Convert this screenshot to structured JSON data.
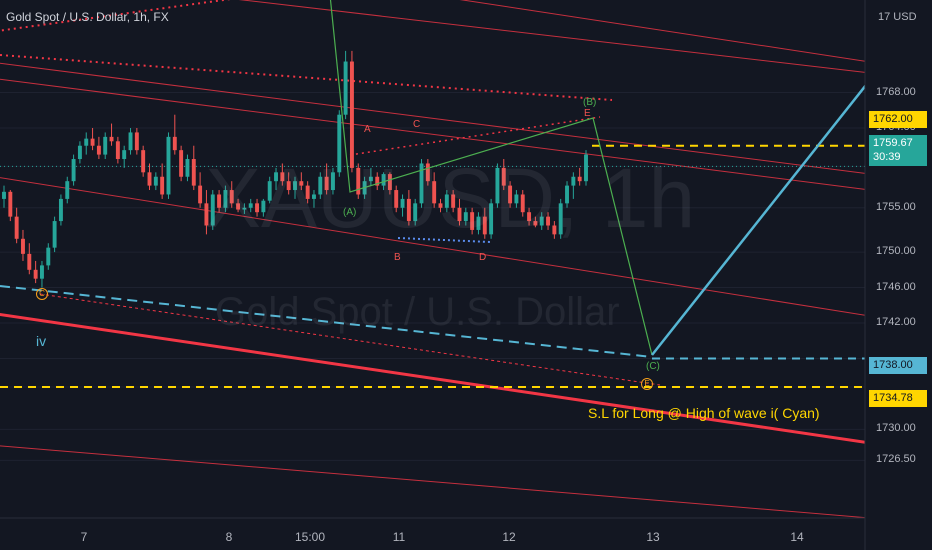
{
  "header": {
    "symbol_title": "Gold Spot / U.S. Dollar, 1h, FX"
  },
  "watermark": {
    "ticker": "XAUUSD, 1h",
    "name": "Gold Spot / U.S. Dollar"
  },
  "currency_label": "17 USD",
  "last_price": {
    "price": "1759.67",
    "countdown": "30:39"
  },
  "labels": {
    "sl_note": "S.L for Long @ High of wave i( Cyan)",
    "iv": "iv",
    "A": "A",
    "B": "B",
    "C": "C",
    "D": "D",
    "E": "E",
    "wA": "(A)",
    "wB": "(B)",
    "wC": "(C)",
    "cC": "C",
    "cE": "E"
  },
  "colors": {
    "background": "#131722",
    "up": "#26a69a",
    "down": "#ef5350",
    "channel_red": "#f23645",
    "yellow_level": "#ffd600",
    "cyan": "#56b6d4",
    "wave_green": "#4caf50",
    "orange": "#f7a21b"
  },
  "chart_data": {
    "type": "candlestick",
    "symbol": "XAUUSD",
    "timeframe": "1h",
    "y_axis_ticks": [
      1768.0,
      1764.0,
      1759.67,
      1755.0,
      1750.0,
      1746.0,
      1742.0,
      1738.0,
      1734.78,
      1730.0,
      1726.5
    ],
    "ylim": [
      1723.5,
      1772.7
    ],
    "x_axis_ticks": [
      "7",
      "8",
      "15:00",
      "11",
      "12",
      "13",
      "14"
    ],
    "horizontal_levels": [
      {
        "price": 1762.0,
        "label": "1762.00",
        "style": "dashed",
        "color": "yellow"
      },
      {
        "price": 1738.0,
        "label": "1738.00",
        "style": "dashed",
        "color": "cyan"
      },
      {
        "price": 1734.78,
        "label": "1734.78",
        "style": "dashed",
        "color": "yellow"
      }
    ],
    "last_price": 1759.67,
    "candles_ohlc": [
      [
        1756,
        1757.5,
        1755,
        1756.8
      ],
      [
        1756.8,
        1757,
        1753.5,
        1754
      ],
      [
        1754,
        1755,
        1751,
        1751.5
      ],
      [
        1751.5,
        1752.5,
        1749,
        1749.8
      ],
      [
        1749.8,
        1751,
        1747.5,
        1748
      ],
      [
        1748,
        1749,
        1746.5,
        1747
      ],
      [
        1747,
        1749,
        1746,
        1748.5
      ],
      [
        1748.5,
        1751,
        1748,
        1750.5
      ],
      [
        1750.5,
        1754,
        1750,
        1753.5
      ],
      [
        1753.5,
        1756.5,
        1753,
        1756
      ],
      [
        1756,
        1758.5,
        1755.5,
        1758
      ],
      [
        1758,
        1761,
        1757.5,
        1760.5
      ],
      [
        1760.5,
        1762.5,
        1760,
        1762
      ],
      [
        1762,
        1763.5,
        1761,
        1762.8
      ],
      [
        1762.8,
        1764,
        1761.5,
        1762
      ],
      [
        1762,
        1763,
        1760.5,
        1761
      ],
      [
        1761,
        1763.5,
        1760.5,
        1763
      ],
      [
        1763,
        1764.5,
        1762,
        1762.5
      ],
      [
        1762.5,
        1763,
        1760,
        1760.5
      ],
      [
        1760.5,
        1762,
        1759.5,
        1761.5
      ],
      [
        1761.5,
        1764,
        1761,
        1763.5
      ],
      [
        1763.5,
        1764,
        1761,
        1761.5
      ],
      [
        1761.5,
        1762,
        1758.5,
        1759
      ],
      [
        1759,
        1760,
        1757,
        1757.5
      ],
      [
        1757.5,
        1759,
        1757,
        1758.5
      ],
      [
        1758.5,
        1760,
        1756,
        1756.5
      ],
      [
        1756.5,
        1763.5,
        1756,
        1763
      ],
      [
        1763,
        1765.5,
        1761,
        1761.5
      ],
      [
        1761.5,
        1762,
        1758,
        1758.5
      ],
      [
        1758.5,
        1761,
        1758,
        1760.5
      ],
      [
        1760.5,
        1762,
        1757,
        1757.5
      ],
      [
        1757.5,
        1759,
        1755,
        1755.5
      ],
      [
        1755.5,
        1757,
        1752,
        1753
      ],
      [
        1753,
        1757,
        1752.5,
        1756.5
      ],
      [
        1756.5,
        1757,
        1754.5,
        1755
      ],
      [
        1755,
        1757.5,
        1754.5,
        1757
      ],
      [
        1757,
        1758,
        1755,
        1755.5
      ],
      [
        1755.5,
        1756,
        1754.5,
        1754.8
      ],
      [
        1754.8,
        1755.5,
        1754.3,
        1755
      ],
      [
        1755,
        1756,
        1754.5,
        1755.5
      ],
      [
        1755.5,
        1756,
        1754,
        1754.5
      ],
      [
        1754.5,
        1756,
        1754,
        1755.8
      ],
      [
        1755.8,
        1758.5,
        1755.5,
        1758
      ],
      [
        1758,
        1759.5,
        1757,
        1759
      ],
      [
        1759,
        1760,
        1757.5,
        1758
      ],
      [
        1758,
        1759,
        1756.5,
        1757
      ],
      [
        1757,
        1758.5,
        1756,
        1758
      ],
      [
        1758,
        1759,
        1757,
        1757.5
      ],
      [
        1757.5,
        1758,
        1755.5,
        1756
      ],
      [
        1756,
        1757,
        1755,
        1756.5
      ],
      [
        1756.5,
        1759,
        1756,
        1758.5
      ],
      [
        1758.5,
        1760,
        1756.5,
        1757
      ],
      [
        1757,
        1759.5,
        1756.5,
        1759
      ],
      [
        1759,
        1766,
        1758.5,
        1765.5
      ],
      [
        1765.5,
        1772.7,
        1765,
        1771.5
      ],
      [
        1771.5,
        1772.7,
        1759,
        1759.5
      ],
      [
        1759.5,
        1760,
        1756,
        1756.5
      ],
      [
        1756.5,
        1758.5,
        1756,
        1758
      ],
      [
        1758,
        1759.5,
        1757.5,
        1758.5
      ],
      [
        1758.5,
        1759,
        1757,
        1757.5
      ],
      [
        1757.5,
        1759,
        1757,
        1758.8
      ],
      [
        1758.8,
        1759,
        1756.5,
        1757
      ],
      [
        1757,
        1757.5,
        1754.5,
        1755
      ],
      [
        1755,
        1756.5,
        1754,
        1756
      ],
      [
        1756,
        1757,
        1753,
        1753.5
      ],
      [
        1753.5,
        1756,
        1753,
        1755.5
      ],
      [
        1755.5,
        1760.5,
        1755,
        1760
      ],
      [
        1760,
        1760.5,
        1757.5,
        1758
      ],
      [
        1758,
        1759,
        1755,
        1755.5
      ],
      [
        1755.5,
        1756,
        1754.5,
        1755
      ],
      [
        1755,
        1757,
        1754.5,
        1756.5
      ],
      [
        1756.5,
        1757,
        1754.5,
        1755
      ],
      [
        1755,
        1756,
        1753,
        1753.5
      ],
      [
        1753.5,
        1755,
        1753,
        1754.5
      ],
      [
        1754.5,
        1755,
        1752,
        1752.5
      ],
      [
        1752.5,
        1754.5,
        1752,
        1754
      ],
      [
        1754,
        1755,
        1751.5,
        1752
      ],
      [
        1752,
        1756,
        1751.5,
        1755.5
      ],
      [
        1755.5,
        1760,
        1755,
        1759.5
      ],
      [
        1759.5,
        1760.5,
        1757,
        1757.5
      ],
      [
        1757.5,
        1758,
        1755,
        1755.5
      ],
      [
        1755.5,
        1757,
        1755,
        1756.5
      ],
      [
        1756.5,
        1757,
        1754,
        1754.5
      ],
      [
        1754.5,
        1755,
        1753,
        1753.5
      ],
      [
        1753.5,
        1754,
        1752.8,
        1753
      ],
      [
        1753,
        1754.5,
        1752.5,
        1754
      ],
      [
        1754,
        1754.5,
        1752.5,
        1753
      ],
      [
        1753,
        1753.5,
        1751.5,
        1752
      ],
      [
        1752,
        1756,
        1751.5,
        1755.5
      ],
      [
        1755.5,
        1758,
        1755,
        1757.5
      ],
      [
        1757.5,
        1759,
        1756,
        1758.5
      ],
      [
        1758.5,
        1759.5,
        1757.5,
        1758
      ],
      [
        1758,
        1761.5,
        1757.5,
        1761
      ]
    ]
  }
}
